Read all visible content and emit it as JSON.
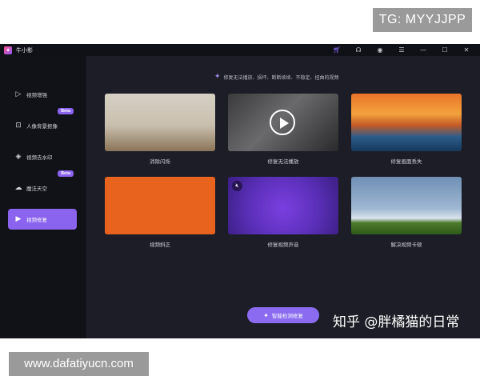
{
  "overlays": {
    "tg_badge": "TG: MYYJJPP",
    "url_badge": "www.dafatiyucn.com",
    "watermark": "知乎 @胖橘猫的日常"
  },
  "titlebar": {
    "app_name": "牛小影",
    "icons": [
      "cart-icon",
      "headset-icon",
      "user-icon",
      "menu-icon",
      "minimize-icon",
      "maximize-icon",
      "close-icon"
    ]
  },
  "sidebar": {
    "items": [
      {
        "label": "视频增强",
        "icon": "play-screen-icon",
        "badge": ""
      },
      {
        "label": "人像背景抠像",
        "icon": "portrait-icon",
        "badge": "Beta"
      },
      {
        "label": "视频去水印",
        "icon": "eraser-icon",
        "badge": ""
      },
      {
        "label": "魔法天空",
        "icon": "cloud-icon",
        "badge": "Beta"
      },
      {
        "label": "视频修复",
        "icon": "repair-screen-icon",
        "badge": "",
        "active": true
      }
    ]
  },
  "main": {
    "hint": "修复无法播放、损坏、断断续续、不稳定、扭曲的视频",
    "cards": [
      {
        "label": "消除闪烁"
      },
      {
        "label": "修复无法播放"
      },
      {
        "label": "修复画面丢失"
      },
      {
        "label": "视频斜正"
      },
      {
        "label": "修复视频声音"
      },
      {
        "label": "解决视频卡顿"
      }
    ],
    "smart_button": "智能检测修复"
  },
  "colors": {
    "accent": "#8a63ee",
    "sidebar_bg": "#111218",
    "main_bg": "#1c1d26"
  }
}
